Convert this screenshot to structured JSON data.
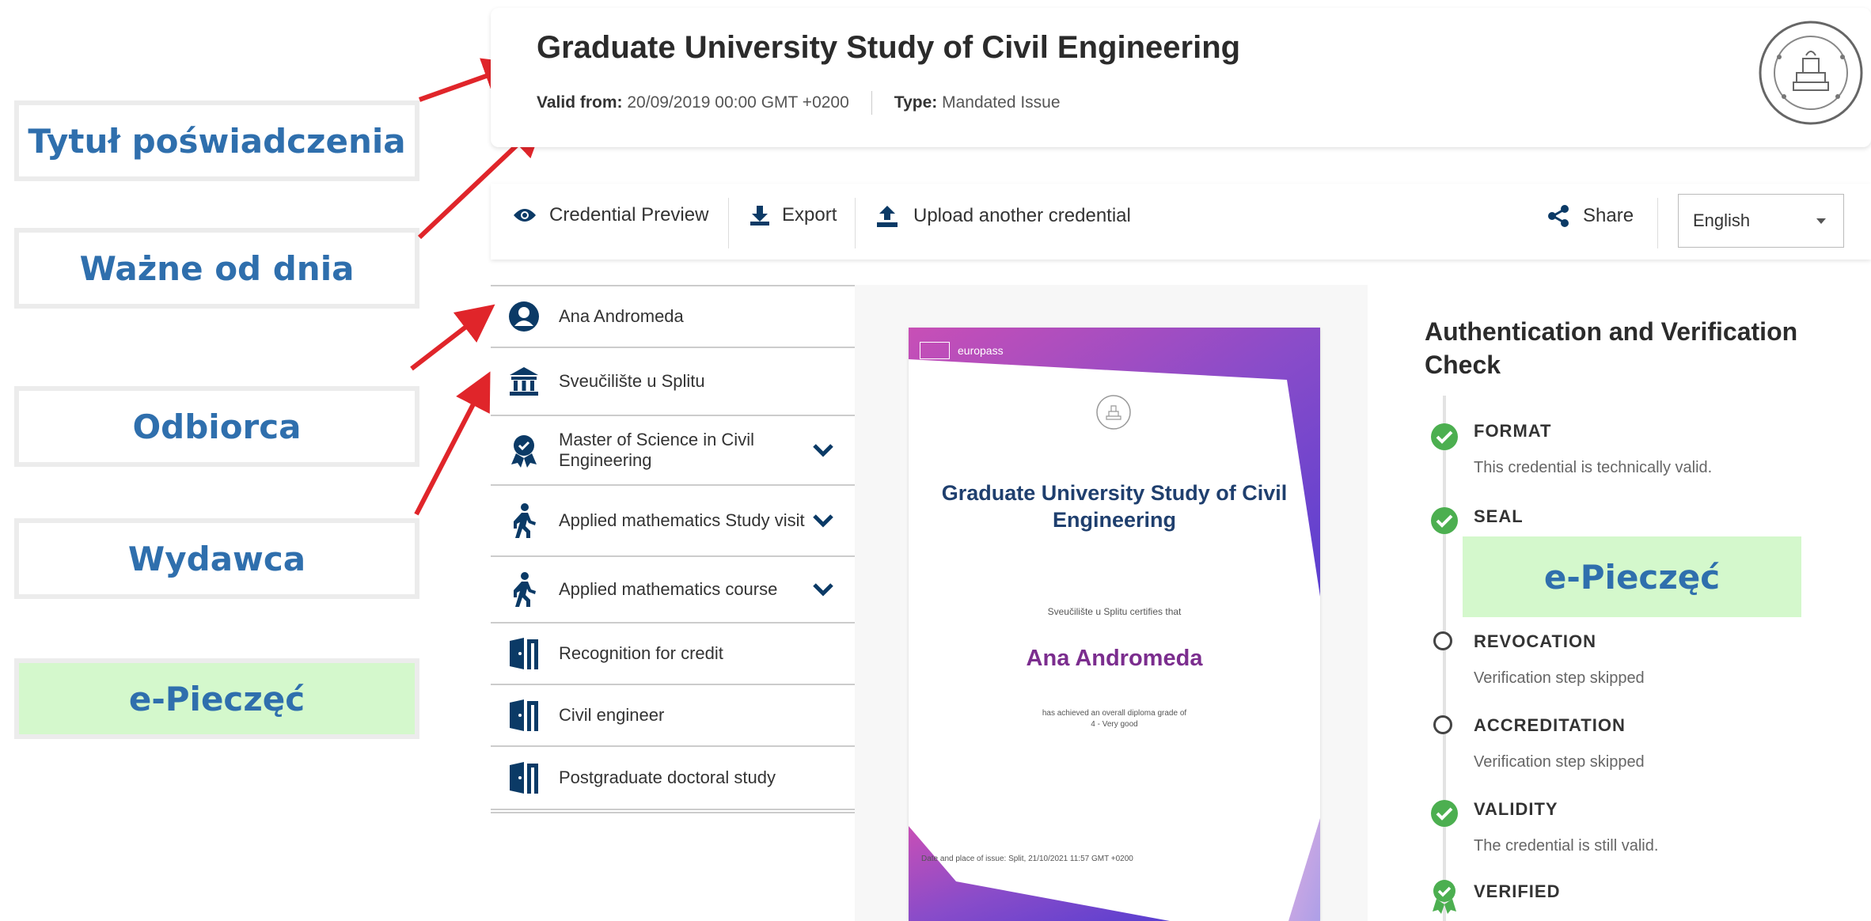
{
  "annotations": {
    "title_label": "Tytuł poświadczenia",
    "valid_from_label": "Ważne od dnia",
    "recipient_label": "Odbiorca",
    "issuer_label": "Wydawca",
    "eseal_label": "e-Pieczęć"
  },
  "header": {
    "title": "Graduate University Study of Civil Engineering",
    "valid_from_key": "Valid from:",
    "valid_from_value": "20/09/2019 00:00 GMT +0200",
    "type_key": "Type:",
    "type_value": "Mandated Issue"
  },
  "toolbar": {
    "preview_label": "Credential Preview",
    "export_label": "Export",
    "upload_label": "Upload another credential",
    "share_label": "Share",
    "language": "English"
  },
  "nav": {
    "items": [
      {
        "label": "Ana Andromeda",
        "icon": "person-icon"
      },
      {
        "label": "Sveučilište u Splitu",
        "icon": "institution-icon"
      },
      {
        "label": "Master of Science in Civil Engineering",
        "icon": "award-icon"
      },
      {
        "label": "Applied mathematics Study visit",
        "icon": "walking-icon"
      },
      {
        "label": "Applied mathematics course",
        "icon": "walking-icon"
      },
      {
        "label": "Recognition for credit",
        "icon": "door-icon"
      },
      {
        "label": "Civil engineer",
        "icon": "door-icon"
      },
      {
        "label": "Postgraduate doctoral study",
        "icon": "door-icon"
      }
    ]
  },
  "preview": {
    "brand": "europass",
    "title": "Graduate University Study of Civil Engineering",
    "certifies": "Sveučilište u Splitu certifies that",
    "recipient": "Ana Andromeda",
    "achievement": "has achieved an overall diploma grade of",
    "grade": "4 - Very good",
    "issue_line": "Date and place of issue: Split, 21/10/2021 11:57 GMT +0200"
  },
  "verification": {
    "title": "Authentication and Verification Check",
    "eseal_label": "e-Pieczęć",
    "steps": [
      {
        "label": "FORMAT",
        "desc": "This credential is technically valid.",
        "status": "ok"
      },
      {
        "label": "SEAL",
        "desc": "",
        "status": "ok"
      },
      {
        "label": "REVOCATION",
        "desc": "Verification step skipped",
        "status": "skipped"
      },
      {
        "label": "ACCREDITATION",
        "desc": "Verification step skipped",
        "status": "skipped"
      },
      {
        "label": "VALIDITY",
        "desc": "The credential is still valid.",
        "status": "ok"
      },
      {
        "label": "VERIFIED",
        "desc": "",
        "status": "verified"
      }
    ]
  },
  "colors": {
    "accent_blue": "#2f6fad",
    "highlight_green": "#d4f8cc",
    "ok_green": "#4caf50",
    "icon_navy": "#0b3a66",
    "arrow_red": "#e0252a"
  }
}
